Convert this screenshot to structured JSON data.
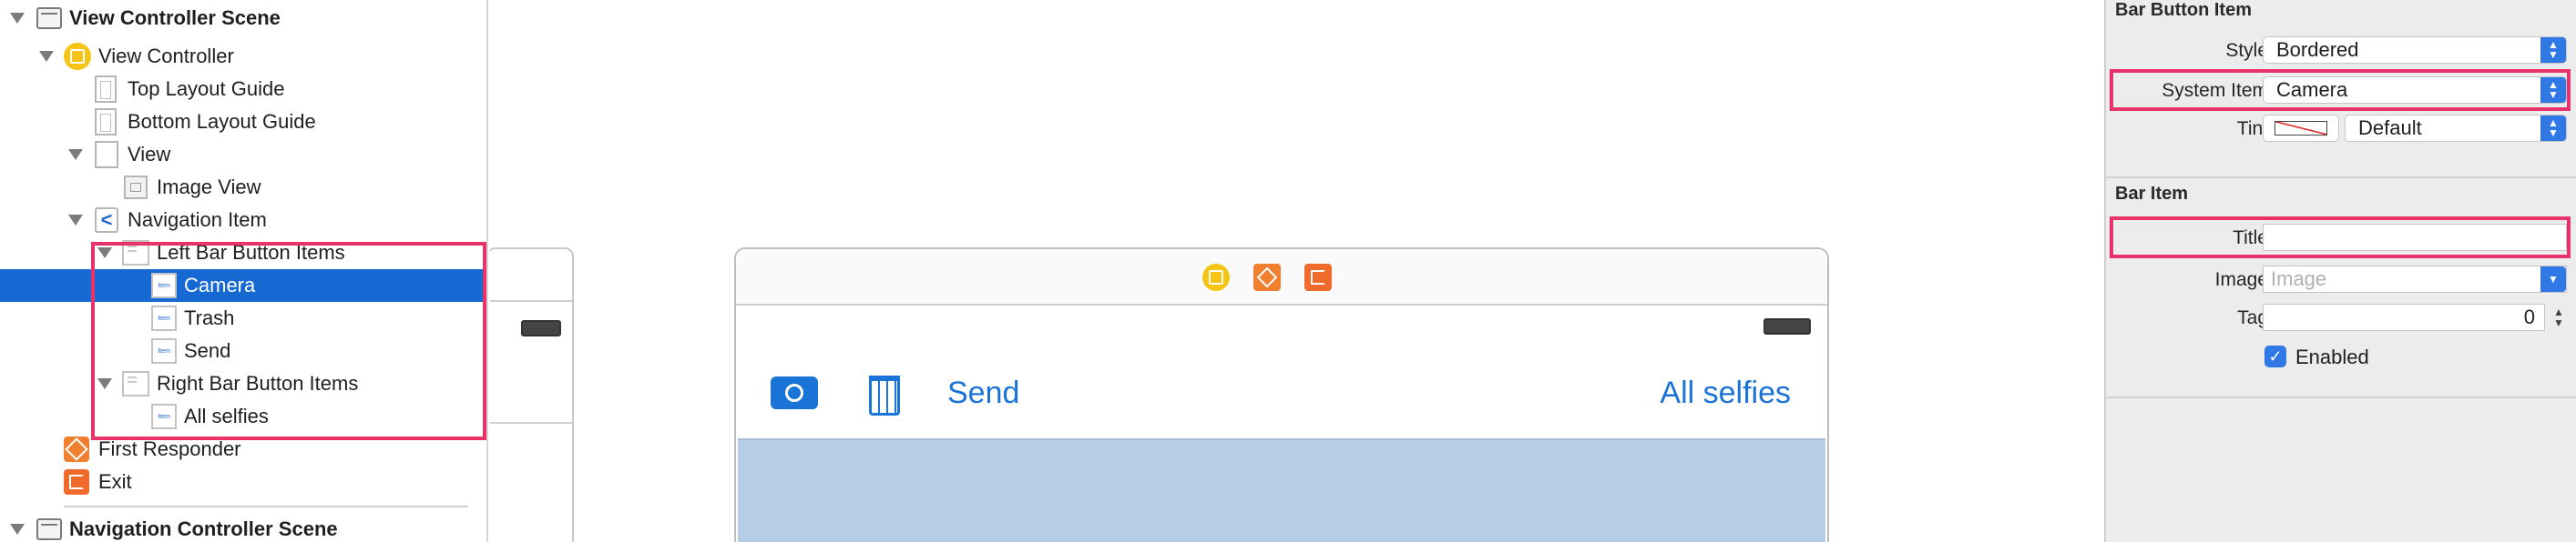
{
  "outline": {
    "view_controller_scene": "View Controller Scene",
    "view_controller": "View Controller",
    "top_layout_guide": "Top Layout Guide",
    "bottom_layout_guide": "Bottom Layout Guide",
    "view": "View",
    "image_view": "Image View",
    "navigation_item": "Navigation Item",
    "left_bar_button_items": "Left Bar Button Items",
    "camera": "Camera",
    "trash": "Trash",
    "send": "Send",
    "right_bar_button_items": "Right Bar Button Items",
    "all_selfies": "All selfies",
    "first_responder": "First Responder",
    "exit": "Exit",
    "navigation_controller_scene": "Navigation Controller Scene",
    "item_icon_text": "Item",
    "nav_icon_text": "<"
  },
  "canvas": {
    "send_label": "Send",
    "all_selfies_label": "All selfies"
  },
  "inspector": {
    "bar_button_item_header": "Bar Button Item",
    "style_label": "Style",
    "style_value": "Bordered",
    "system_item_label": "System Item",
    "system_item_value": "Camera",
    "tint_label": "Tint",
    "tint_value": "Default",
    "bar_item_header": "Bar Item",
    "title_label": "Title",
    "title_value": "",
    "image_label": "Image",
    "image_placeholder": "Image",
    "tag_label": "Tag",
    "tag_value": "0",
    "enabled_label": "Enabled"
  },
  "colors": {
    "selection": "#1669d3",
    "highlight": "#e8336a",
    "tint": "#1a73d6",
    "content": "#b7cde5"
  },
  "icons": [
    "disclosure-triangle-icon",
    "scene-icon",
    "view-controller-icon",
    "layout-guide-icon",
    "view-icon",
    "image-view-icon",
    "navigation-item-icon",
    "bar-button-items-icon",
    "bar-button-item-icon",
    "first-responder-icon",
    "exit-icon",
    "camera-icon",
    "trash-icon",
    "battery-icon",
    "checkmark-icon"
  ]
}
